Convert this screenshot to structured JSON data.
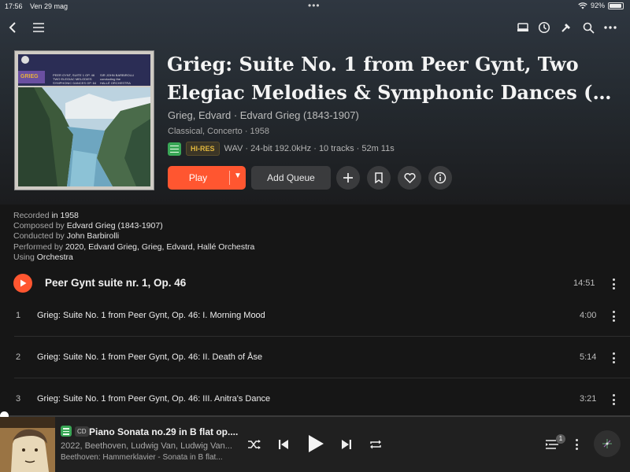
{
  "status_bar": {
    "time": "17:56",
    "date": "Ven 29 mag",
    "battery": "92%",
    "battery_level": 0.92
  },
  "nav": {
    "icons": [
      "back-icon",
      "menu-icon",
      "device-icon",
      "history-icon",
      "tools-icon",
      "search-icon",
      "more-icon"
    ]
  },
  "album": {
    "title_line1": "Grieg: Suite No. 1 from Peer Gynt, Two",
    "title_line2": "Elegiac Melodies & Symphonic Dances (re…",
    "artist": "Grieg, Edvard · Edvard Grieg (1843-1907)",
    "genre": "Classical, Concerto · 1958",
    "quality_badge": "HI-RES",
    "format": "WAV · 24-bit 192.0kHz · 10 tracks · 52m 11s",
    "cover": {
      "label": "GRIEG",
      "text_left": [
        "PEER GYNT, SUITE 1 OP. 46",
        "TWO ELEGIAC MELODIES",
        "SYMPHONIC DANCES OP. 64"
      ],
      "text_right": [
        "SIR JOHN BARBIROLLI",
        "conducting the",
        "HALLÉ ORCHESTRA"
      ]
    }
  },
  "actions": {
    "play_label": "Play",
    "queue_label": "Add Queue",
    "accent": "#ff5630"
  },
  "credits": [
    {
      "label": "Recorded ",
      "value": " in 1958"
    },
    {
      "label": "Composed by ",
      "value": "Edvard Grieg (1843-1907)"
    },
    {
      "label": "Conducted by ",
      "value": "John Barbirolli"
    },
    {
      "label": "Performed by ",
      "value": "2020, Edvard Grieg, Grieg, Edvard, Hallé Orchestra"
    },
    {
      "label": "Using ",
      "value": "Orchestra"
    }
  ],
  "work": {
    "title": "Peer Gynt suite nr. 1, Op. 46",
    "duration": "14:51"
  },
  "tracks": [
    {
      "num": "1",
      "name": "Grieg: Suite No. 1 from Peer Gynt, Op. 46: I. Morning Mood",
      "duration": "4:00"
    },
    {
      "num": "2",
      "name": "Grieg: Suite No. 1 from Peer Gynt, Op. 46: II. Death of Åse",
      "duration": "5:14"
    },
    {
      "num": "3",
      "name": "Grieg: Suite No. 1 from Peer Gynt, Op. 46: III. Anitra's Dance",
      "duration": "3:21"
    }
  ],
  "mini_player": {
    "format_badge": "CD",
    "title": "Piano Sonata no.29 in B flat op....",
    "subtitle": "2022, Beethoven, Ludwig Van, Ludwig Van...",
    "album": "Beethoven: Hammerklavier - Sonata in B flat...",
    "queue_count": "1",
    "progress": 0.0
  }
}
